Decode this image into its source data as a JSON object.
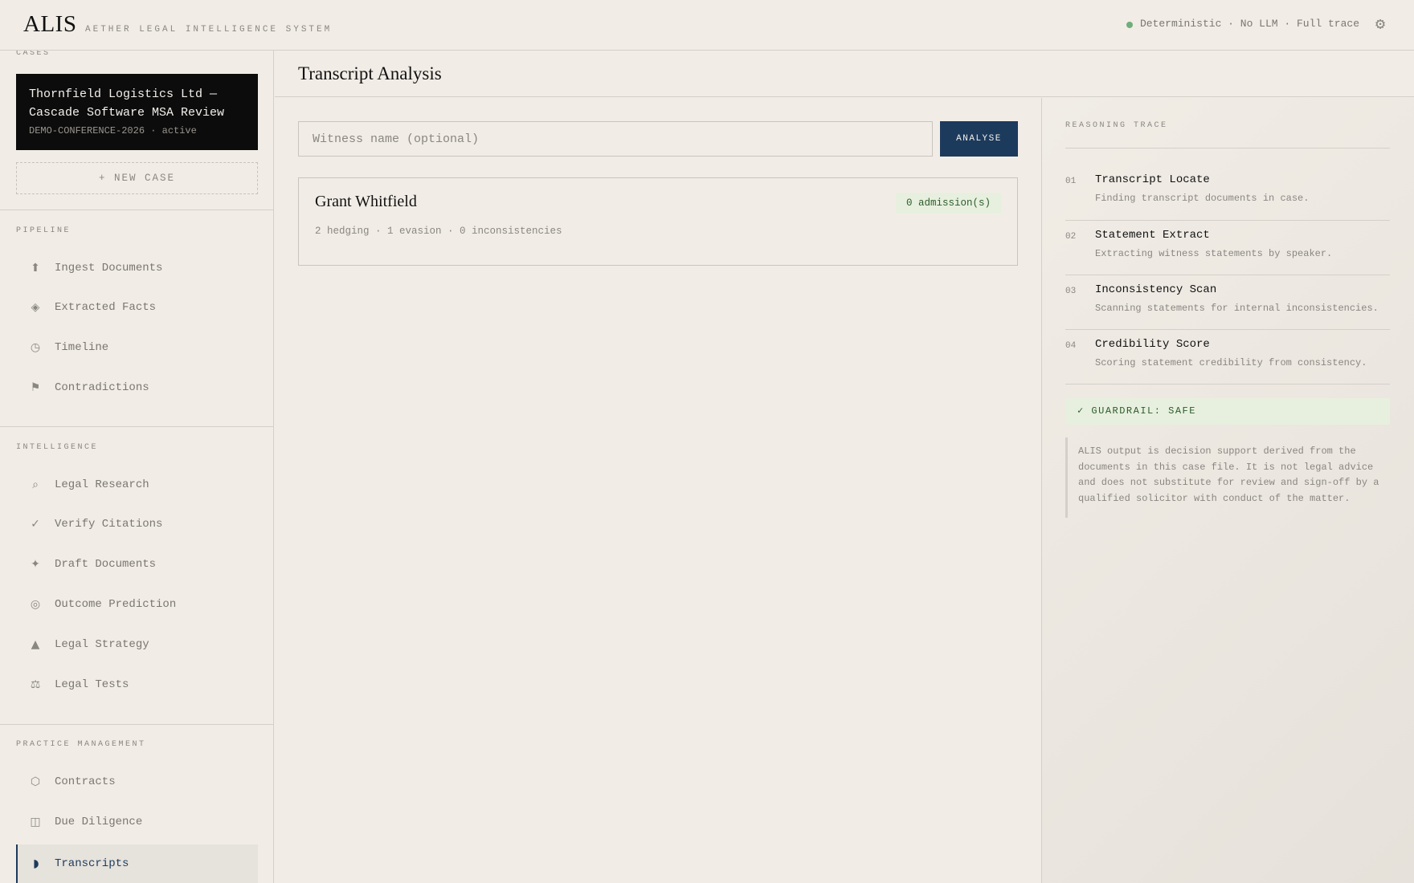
{
  "header": {
    "brand": "ALIS",
    "subtitle": "AETHER LEGAL INTELLIGENCE SYSTEM",
    "status": "Deterministic · No LLM · Full trace",
    "status_color": "#6fae7a",
    "settings_icon": "gear-icon"
  },
  "sidebar": {
    "cases_label": "CASES",
    "active_case": {
      "title": "Thornfield Logistics Ltd — Cascade Software MSA Review",
      "meta": "DEMO-CONFERENCE-2026 · active"
    },
    "new_case_label": "+ NEW CASE",
    "groups": [
      {
        "label": "PIPELINE",
        "items": [
          {
            "label": "Ingest Documents",
            "icon": "upload-icon",
            "glyph": "⬆"
          },
          {
            "label": "Extracted Facts",
            "icon": "diamond-icon",
            "glyph": "◈"
          },
          {
            "label": "Timeline",
            "icon": "clock-icon",
            "glyph": "◷"
          },
          {
            "label": "Contradictions",
            "icon": "flag-icon",
            "glyph": "⚑"
          }
        ]
      },
      {
        "label": "INTELLIGENCE",
        "items": [
          {
            "label": "Legal Research",
            "icon": "search-icon",
            "glyph": "⌕"
          },
          {
            "label": "Verify Citations",
            "icon": "check-icon",
            "glyph": "✓"
          },
          {
            "label": "Draft Documents",
            "icon": "sparkle-icon",
            "glyph": "✦"
          },
          {
            "label": "Outcome Prediction",
            "icon": "target-icon",
            "glyph": "◎"
          },
          {
            "label": "Legal Strategy",
            "icon": "triangle-icon",
            "glyph": "▲"
          },
          {
            "label": "Legal Tests",
            "icon": "scales-icon",
            "glyph": "⚖"
          }
        ]
      },
      {
        "label": "PRACTICE MANAGEMENT",
        "items": [
          {
            "label": "Contracts",
            "icon": "hexagon-icon",
            "glyph": "⬡"
          },
          {
            "label": "Due Diligence",
            "icon": "panel-icon",
            "glyph": "◫"
          },
          {
            "label": "Transcripts",
            "icon": "half-circle-icon",
            "glyph": "◗"
          }
        ]
      }
    ],
    "active_item": "Transcripts",
    "accent_color": "#1c3a5c"
  },
  "main": {
    "title": "Transcript Analysis",
    "witness_placeholder": "Witness name (optional)",
    "analyse_label": "ANALYSE",
    "result": {
      "name": "Grant Whitfield",
      "admissions": "0 admission(s)",
      "stats": "2 hedging · 1 evasion · 0 inconsistencies"
    }
  },
  "trace": {
    "label": "REASONING TRACE",
    "steps": [
      {
        "num": "01",
        "title": "Transcript Locate",
        "desc": "Finding transcript documents in case."
      },
      {
        "num": "02",
        "title": "Statement Extract",
        "desc": "Extracting witness statements by speaker."
      },
      {
        "num": "03",
        "title": "Inconsistency Scan",
        "desc": "Scanning statements for internal inconsistencies."
      },
      {
        "num": "04",
        "title": "Credibility Score",
        "desc": "Scoring statement credibility from consistency."
      }
    ],
    "guardrail": "✓ GUARDRAIL: SAFE",
    "disclaimer": "ALIS output is decision support derived from the documents in this case file. It is not legal advice and does not substitute for review and sign-off by a qualified solicitor with conduct of the matter."
  }
}
